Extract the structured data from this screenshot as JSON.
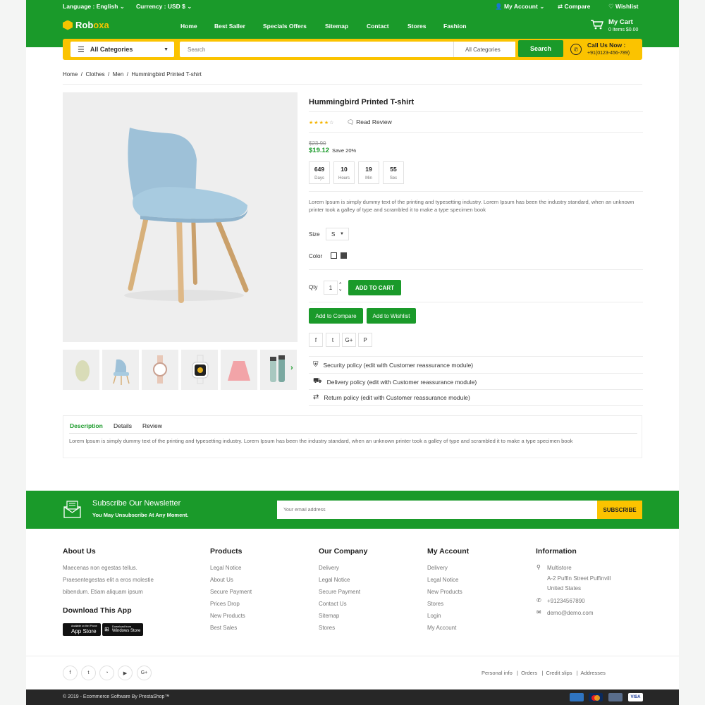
{
  "topbar": {
    "language": "Language : English",
    "currency": "Currency : USD $",
    "account": "My Account",
    "compare": "Compare",
    "wishlist": "Wishlist"
  },
  "brand": {
    "prefix": "Rob",
    "suffix": "oxa"
  },
  "menu": [
    "Home",
    "Best Saller",
    "Specials Offers",
    "Sitemap",
    "Contact",
    "Stores",
    "Fashion"
  ],
  "cart": {
    "title": "My Cart",
    "summary": "0 Items $0.00"
  },
  "search": {
    "category": "All Categories",
    "placeholder": "Search",
    "scope": "All Categories",
    "button": "Search",
    "call_title": "Call Us Now :",
    "call_number": "+91(0123-456-789)"
  },
  "breadcrumb": [
    "Home",
    "Clothes",
    "Men",
    "Hummingbird Printed T-shirt"
  ],
  "product": {
    "title": "Hummingbird Printed T-shirt",
    "rating": 4,
    "rating_max": 5,
    "read_review": "Read Review",
    "old_price": "$23.90",
    "price": "$19.12",
    "save": "Save 20%",
    "countdown": [
      {
        "n": "649",
        "l": "Days"
      },
      {
        "n": "10",
        "l": "Hours"
      },
      {
        "n": "19",
        "l": "Min"
      },
      {
        "n": "55",
        "l": "Sec"
      }
    ],
    "description": "Lorem Ipsum is simply dummy text of the printing and typesetting industry. Lorem Ipsum has been the industry standard, when an unknown printer took a galley of type and scrambled it to make a type specimen book",
    "size_label": "Size",
    "size_value": "S",
    "color_label": "Color",
    "qty_label": "Qty",
    "qty_value": "1",
    "add_to_cart": "ADD TO CART",
    "add_to_compare": "Add to Compare",
    "add_to_wishlist": "Add to Wishlist",
    "share": [
      "f",
      "t",
      "G+",
      "P"
    ],
    "policies": [
      "Security policy (edit with Customer reassurance module)",
      "Delivery policy (edit with Customer reassurance module)",
      "Return policy (edit with Customer reassurance module)"
    ]
  },
  "tabs": {
    "items": [
      "Description",
      "Details",
      "Review"
    ],
    "content": "Lorem Ipsum is simply dummy text of the printing and typesetting industry. Lorem Ipsum has been the industry standard, when an unknown printer took a galley of type and scrambled it to make a type specimen book"
  },
  "newsletter": {
    "title": "Subscribe Our Newsletter",
    "subtitle": "You May Unsubscribe At Any Moment.",
    "placeholder": "Your email address",
    "button": "SUBSCRIBE"
  },
  "footer": {
    "about_title": "About Us",
    "about_lines": [
      "Maecenas non egestas tellus.",
      "Praesentegestas elit a eros molestie",
      "bibendum. Etiam aliquam ipsum"
    ],
    "app_title": "Download This App",
    "app_store_small": "Available on the iPhone",
    "app_store": "App Store",
    "win_store_small": "Download from",
    "win_store": "Windows Store",
    "products_title": "Products",
    "products": [
      "Legal Notice",
      "About Us",
      "Secure Payment",
      "Prices Drop",
      "New Products",
      "Best Sales"
    ],
    "company_title": "Our Company",
    "company": [
      "Delivery",
      "Legal Notice",
      "Secure Payment",
      "Contact Us",
      "Sitemap",
      "Stores"
    ],
    "account_title": "My Account",
    "account": [
      "Delivery",
      "Legal Notice",
      "New Products",
      "Stores",
      "Login",
      "My Account"
    ],
    "info_title": "Information",
    "info_store": "Multistore",
    "info_address1": "A-2 Puffin Street Puffinvill",
    "info_address2": "United States",
    "info_phone": "+91234567890",
    "info_email": "demo@demo.com",
    "social": [
      "f",
      "t",
      "rss",
      "yt",
      "G+"
    ],
    "links": [
      "Personal info",
      "Orders",
      "Credit slips",
      "Addresses"
    ],
    "copyright": "© 2019 - Ecommerce Software By PrestaShop™",
    "payments": [
      "amex",
      "mastercard",
      "discover",
      "VISA"
    ]
  },
  "colors": {
    "green": "#1a9a2a",
    "yellow": "#fbc300"
  }
}
